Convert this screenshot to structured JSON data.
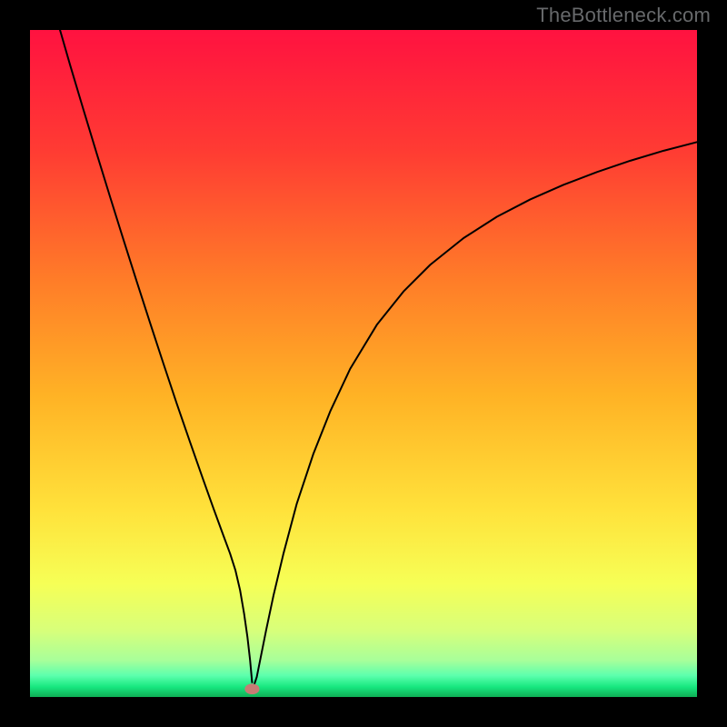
{
  "watermark": "TheBottleneck.com",
  "chart_data": {
    "type": "line",
    "title": "",
    "xlabel": "",
    "ylabel": "",
    "xlim": [
      0,
      100
    ],
    "ylim": [
      0,
      100
    ],
    "grid": false,
    "gradient_stops": [
      {
        "offset": 0.0,
        "color": "#ff1240"
      },
      {
        "offset": 0.18,
        "color": "#ff3b33"
      },
      {
        "offset": 0.38,
        "color": "#ff7e28"
      },
      {
        "offset": 0.55,
        "color": "#ffb325"
      },
      {
        "offset": 0.72,
        "color": "#ffe23b"
      },
      {
        "offset": 0.83,
        "color": "#f6ff56"
      },
      {
        "offset": 0.9,
        "color": "#d8ff7a"
      },
      {
        "offset": 0.945,
        "color": "#a8ff9a"
      },
      {
        "offset": 0.968,
        "color": "#5cffad"
      },
      {
        "offset": 0.985,
        "color": "#17e77f"
      },
      {
        "offset": 1.0,
        "color": "#0fae55"
      }
    ],
    "series": [
      {
        "name": "left-branch",
        "color": "#000000",
        "x": [
          4.5,
          6,
          8,
          10,
          12,
          14,
          16,
          18,
          20,
          22,
          24,
          26,
          27.5,
          29,
          30,
          30.8,
          31.5,
          32.1,
          32.6,
          33.0,
          33.3
        ],
        "y": [
          100,
          94.8,
          88.1,
          81.5,
          75.0,
          68.6,
          62.3,
          56.1,
          50.0,
          44.0,
          38.2,
          32.5,
          28.3,
          24.2,
          21.5,
          19.0,
          16.0,
          12.5,
          9.0,
          5.5,
          2.2
        ]
      },
      {
        "name": "right-branch",
        "color": "#000000",
        "x": [
          33.5,
          34.0,
          34.6,
          35.4,
          36.5,
          38,
          40,
          42.5,
          45,
          48,
          52,
          56,
          60,
          65,
          70,
          75,
          80,
          85,
          90,
          95,
          100
        ],
        "y": [
          1.5,
          3.0,
          6.0,
          10.0,
          15.2,
          21.5,
          29.0,
          36.5,
          42.8,
          49.2,
          55.8,
          60.8,
          64.8,
          68.8,
          72.0,
          74.6,
          76.8,
          78.7,
          80.4,
          81.9,
          83.2
        ]
      }
    ],
    "marker": {
      "x": 33.3,
      "y": 1.2,
      "rx": 1.1,
      "ry": 0.8,
      "color": "#c67c74"
    }
  }
}
